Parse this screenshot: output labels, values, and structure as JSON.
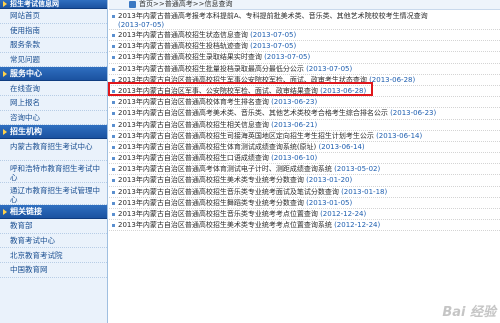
{
  "sidebar": {
    "sections": [
      {
        "title": "招生考试信息网",
        "items": [
          "网站首页",
          "使用指南",
          "服务条款",
          "常见问题"
        ]
      },
      {
        "title": "服务中心",
        "items": [
          "在线查询",
          "网上报名",
          "咨询中心"
        ]
      },
      {
        "title": "招生机构",
        "items": [
          "内蒙古教育招生考试中心",
          "呼和浩特市教育招生考试中心",
          "通辽市教育招生考试管理中心"
        ]
      },
      {
        "title": "相关链接",
        "items": [
          "教育部",
          "教育考试中心",
          "北京教育考试院",
          "中国教育网"
        ]
      }
    ]
  },
  "breadcrumb": "首页>>普通高考>>信息查询",
  "highlight_color": "#e0161b",
  "list": [
    {
      "title": "2013年内蒙古普通高考报考本科提前A、专科提前批美术类、音乐类、其他艺术院校校考生情况查询",
      "date": "(2013-07-05)",
      "wrap": true
    },
    {
      "title": "2013年内蒙古普通高校招生状态信息查询",
      "date": "(2013-07-05)"
    },
    {
      "title": "2013年内蒙古普通高校招生投档轨迹查询",
      "date": "(2013-07-05)"
    },
    {
      "title": "2013年内蒙古普通高校招生录取结果实时查询",
      "date": "(2013-07-05)"
    },
    {
      "title": "2013年内蒙古普通高校招生批量投档录取最高分最低分公示",
      "date": "(2013-07-05)"
    },
    {
      "title": "2013年内蒙古自治区普通高校招生军事公安院校军检、面试、政审考生状态查询",
      "date": "(2013-06-28)"
    },
    {
      "title": "2013年内蒙古自治区军事、公安院校军检、面试、政审结果查询",
      "date": "(2013-06-28)"
    },
    {
      "title": "2013年内蒙古自治区普通高校体育考生排名查询",
      "date": "(2013-06-23)"
    },
    {
      "title": "2013年内蒙古自治区普通高考美术类、音乐类、其他艺术类校考合格考生综合排名公示",
      "date": "(2013-06-23)"
    },
    {
      "title": "2013年内蒙古自治区普通高校招生相关信息查询",
      "date": "(2013-06-21)"
    },
    {
      "title": "2013年内蒙古自治区普通高校招生司接海英国地区定向招生考生招生计划考生公示",
      "date": "(2013-06-14)"
    },
    {
      "title": "2013年内蒙古自治区普通高校招生体育测试成绩查询系统(原址)",
      "date": "(2013-06-14)"
    },
    {
      "title": "2013年内蒙古自治区普通高校招生口语成绩查询",
      "date": "(2013-06-10)"
    },
    {
      "title": "2013年内蒙古自治区普通高考体育测试电子计时、测距成绩查询系统",
      "date": "(2013-05-02)"
    },
    {
      "title": "2013年内蒙古自治区普通高校招生美术类专业统考分数查询",
      "date": "(2013-01-20)"
    },
    {
      "title": "2013年内蒙古自治区普通高校招生音乐类专业统考面试及笔试分数查询",
      "date": "(2013-01-18)"
    },
    {
      "title": "2013年内蒙古自治区普通高校招生舞蹈类专业统考分数查询",
      "date": "(2013-01-05)"
    },
    {
      "title": "2013年内蒙古自治区普通高校招生音乐类专业统考考点位置查询",
      "date": "(2012-12-24)"
    },
    {
      "title": "2013年内蒙古自治区普通高校招生美术类专业统考考点位置查询系统",
      "date": "(2012-12-24)"
    }
  ],
  "watermark": "Bai 经验"
}
